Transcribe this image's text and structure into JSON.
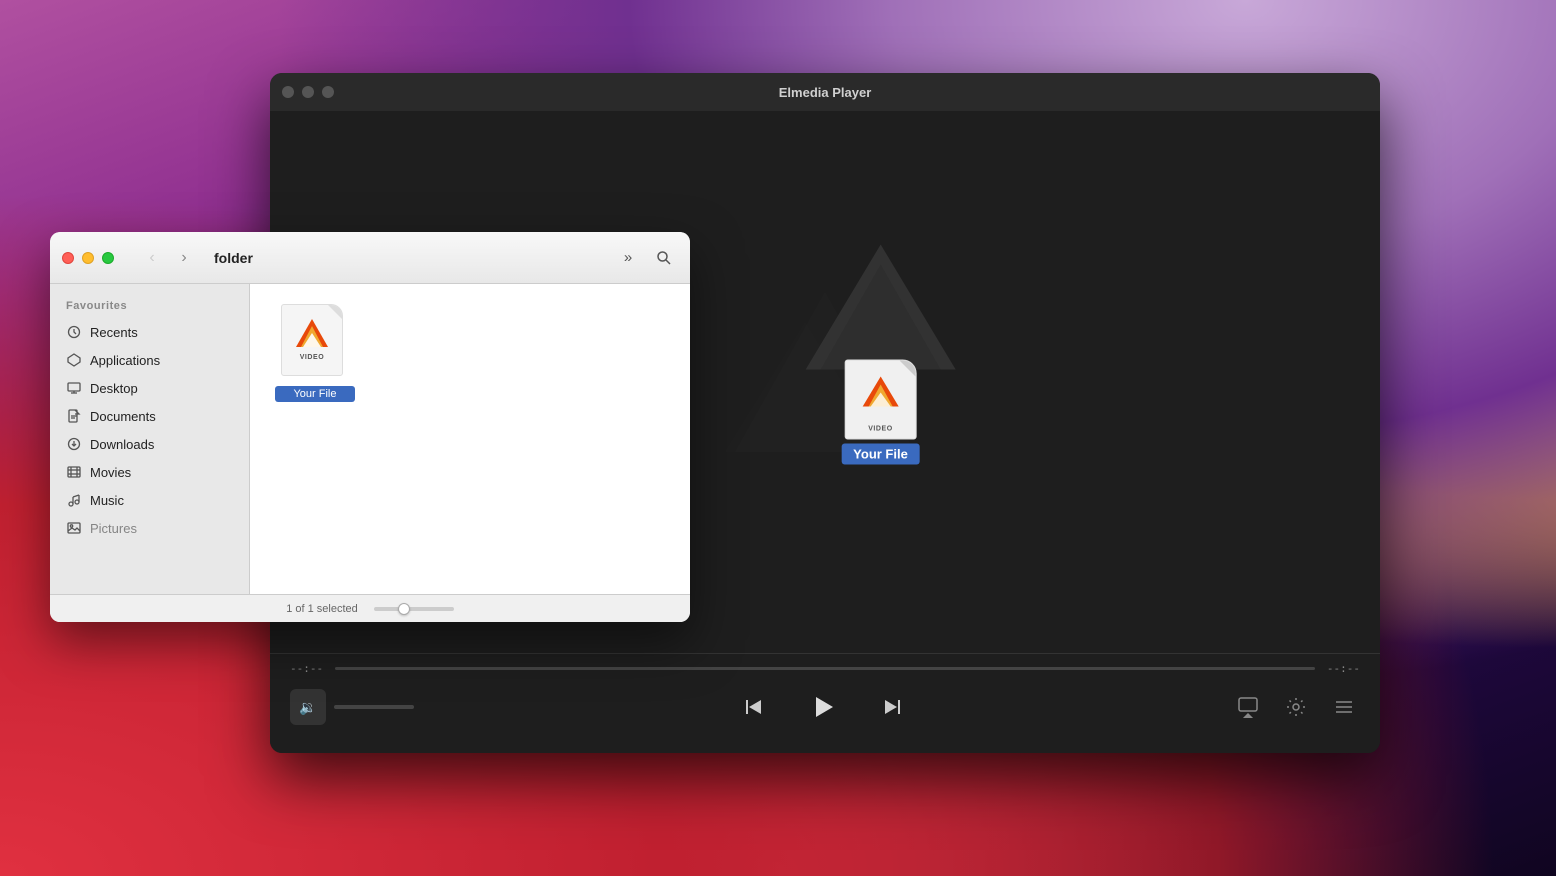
{
  "desktop": {
    "bg_description": "macOS Big Sur style gradient background"
  },
  "player_window": {
    "title": "Elmedia Player",
    "traffic_lights": {
      "close": "close",
      "minimize": "minimize",
      "maximize": "maximize"
    },
    "progress": {
      "current_time": "--:--",
      "total_time": "--:--",
      "fill_percent": 0
    },
    "controls": {
      "prev_label": "⏮",
      "play_label": "▶",
      "next_label": "⏭",
      "airplay_label": "airplay",
      "settings_label": "settings",
      "playlist_label": "playlist"
    },
    "volume": {
      "icon": "🔉"
    },
    "drag_file": {
      "name": "Your File",
      "type": "VIDEO"
    }
  },
  "finder_window": {
    "title": "folder",
    "traffic_lights": {
      "close": "close",
      "minimize": "minimize",
      "maximize": "maximize"
    },
    "nav": {
      "back_disabled": true,
      "forward_disabled": false
    },
    "sidebar": {
      "section_label": "Favourites",
      "items": [
        {
          "id": "recents",
          "label": "Recents",
          "icon": "🕐"
        },
        {
          "id": "applications",
          "label": "Applications",
          "icon": "🚀"
        },
        {
          "id": "desktop",
          "label": "Desktop",
          "icon": "🖥"
        },
        {
          "id": "documents",
          "label": "Documents",
          "icon": "📄"
        },
        {
          "id": "downloads",
          "label": "Downloads",
          "icon": "⬇"
        },
        {
          "id": "movies",
          "label": "Movies",
          "icon": "🎬"
        },
        {
          "id": "music",
          "label": "Music",
          "icon": "♪"
        },
        {
          "id": "pictures",
          "label": "Pictures",
          "icon": "🖼"
        }
      ]
    },
    "file": {
      "name": "Your File",
      "type": "VIDEO"
    },
    "statusbar": {
      "text": "1 of 1 selected"
    }
  }
}
